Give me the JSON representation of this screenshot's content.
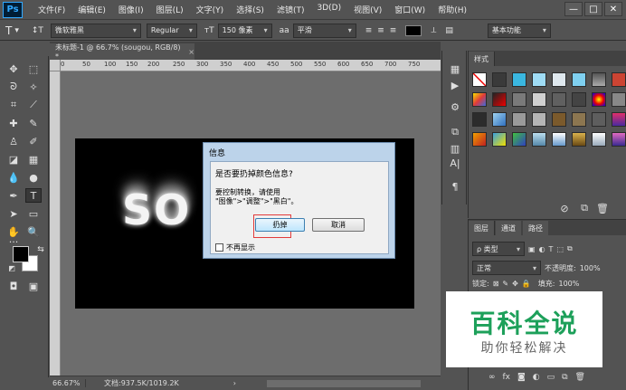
{
  "app": {
    "logo": "Ps"
  },
  "menu": [
    "文件(F)",
    "编辑(E)",
    "图像(I)",
    "图层(L)",
    "文字(Y)",
    "选择(S)",
    "滤镜(T)",
    "3D(D)",
    "视图(V)",
    "窗口(W)",
    "帮助(H)"
  ],
  "window_controls": {
    "minimize": "—",
    "restore": "□",
    "close": "✕"
  },
  "options_bar": {
    "tool_glyph": "T",
    "orient_glyph": "↕T",
    "font_family": "微软雅黑",
    "font_style": "Regular",
    "size_glyph": "тT",
    "font_size": "150 像素",
    "aa_glyph": "aa",
    "antialias": "平滑",
    "workspace": "基本功能"
  },
  "document_tab": {
    "title": "未标题-1 @ 66.7% (sougou, RGB/8) *",
    "close": "×"
  },
  "ruler_ticks": [
    "0",
    "50",
    "100",
    "150",
    "200",
    "250",
    "300",
    "350",
    "400",
    "450",
    "500",
    "550",
    "600",
    "650",
    "700",
    "750"
  ],
  "canvas": {
    "text": "SO"
  },
  "dialog": {
    "title": "信息",
    "question": "是否要扔掉颜色信息?",
    "message_line1": "要控制转换，请使用",
    "message_line2": "\"图像\">\"调整\">\"黑白\"。",
    "ok_label": "扔掉",
    "cancel_label": "取消",
    "checkbox_label": "不再显示"
  },
  "status": {
    "zoom": "66.67%",
    "doc_size": "文档:937.5K/1019.2K",
    "arrow": "›"
  },
  "styles_panel": {
    "tab": "样式"
  },
  "layers_panel": {
    "tabs": [
      "图层",
      "通道",
      "路径"
    ],
    "filter_label": "ρ 类型",
    "blend_mode": "正常",
    "opacity_label": "不透明度:",
    "opacity_value": "100%",
    "lock_label": "锁定:",
    "fill_label": "填充:",
    "fill_value": "100%"
  },
  "watermark": {
    "title": "百科全说",
    "subtitle": "助你轻松解决"
  },
  "colors": {
    "panel_bg": "#535353",
    "canvas_bg": "#000000",
    "workspace_bg": "#6d6d6d",
    "dialog_frame": "#bcd3ea",
    "highlight_red": "#e23b3b",
    "watermark_green": "#1da05a"
  }
}
